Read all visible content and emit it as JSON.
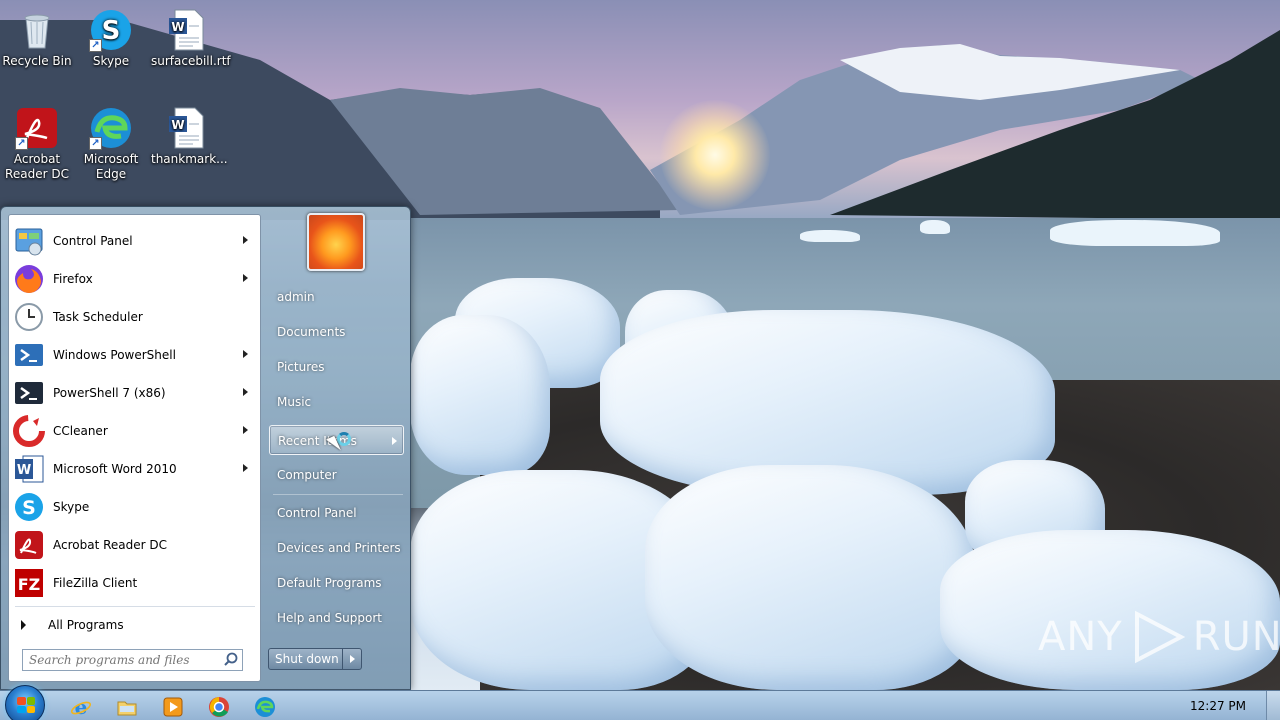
{
  "desktop": {
    "icons": [
      {
        "label": "Recycle Bin",
        "icon": "recycle-bin-icon"
      },
      {
        "label": "Skype",
        "icon": "skype-icon"
      },
      {
        "label": "surfacebill.rtf",
        "icon": "word-document-icon"
      },
      {
        "label": "Acrobat Reader DC",
        "icon": "acrobat-reader-icon"
      },
      {
        "label": "Microsoft Edge",
        "icon": "edge-icon"
      },
      {
        "label": "thankmark...",
        "icon": "word-document-icon"
      }
    ]
  },
  "start_menu": {
    "programs": [
      {
        "label": "Control Panel",
        "icon": "control-panel-icon",
        "submenu": true
      },
      {
        "label": "Firefox",
        "icon": "firefox-icon",
        "submenu": true
      },
      {
        "label": "Task Scheduler",
        "icon": "clock-icon",
        "submenu": false
      },
      {
        "label": "Windows PowerShell",
        "icon": "powershell-icon",
        "submenu": true
      },
      {
        "label": "PowerShell 7 (x86)",
        "icon": "powershell7-icon",
        "submenu": true
      },
      {
        "label": "CCleaner",
        "icon": "ccleaner-icon",
        "submenu": true
      },
      {
        "label": "Microsoft Word 2010",
        "icon": "word-icon",
        "submenu": true
      },
      {
        "label": "Skype",
        "icon": "skype-icon",
        "submenu": false
      },
      {
        "label": "Acrobat Reader DC",
        "icon": "acrobat-reader-icon",
        "submenu": false
      },
      {
        "label": "FileZilla Client",
        "icon": "filezilla-icon",
        "submenu": false
      }
    ],
    "all_programs_label": "All Programs",
    "search_placeholder": "Search programs and files",
    "right_items": [
      {
        "label": "admin"
      },
      {
        "label": "Documents"
      },
      {
        "label": "Pictures"
      },
      {
        "label": "Music"
      },
      {
        "label": "Recent Items",
        "highlighted": true,
        "submenu": true
      },
      {
        "label": "Computer"
      },
      {
        "label": "Control Panel"
      },
      {
        "label": "Devices and Printers"
      },
      {
        "label": "Default Programs"
      },
      {
        "label": "Help and Support"
      }
    ],
    "shutdown_label": "Shut down"
  },
  "taskbar": {
    "pinned": [
      "internet-explorer-icon",
      "explorer-folder-icon",
      "media-player-icon",
      "chrome-icon",
      "edge-icon"
    ],
    "clock": "12:27 PM"
  },
  "watermark": {
    "text_left": "ANY",
    "text_right": "RUN"
  },
  "colors": {
    "taskbar": "#a6c3df",
    "start_menu_right": "#7f99b3",
    "highlight": "#ffffff"
  }
}
